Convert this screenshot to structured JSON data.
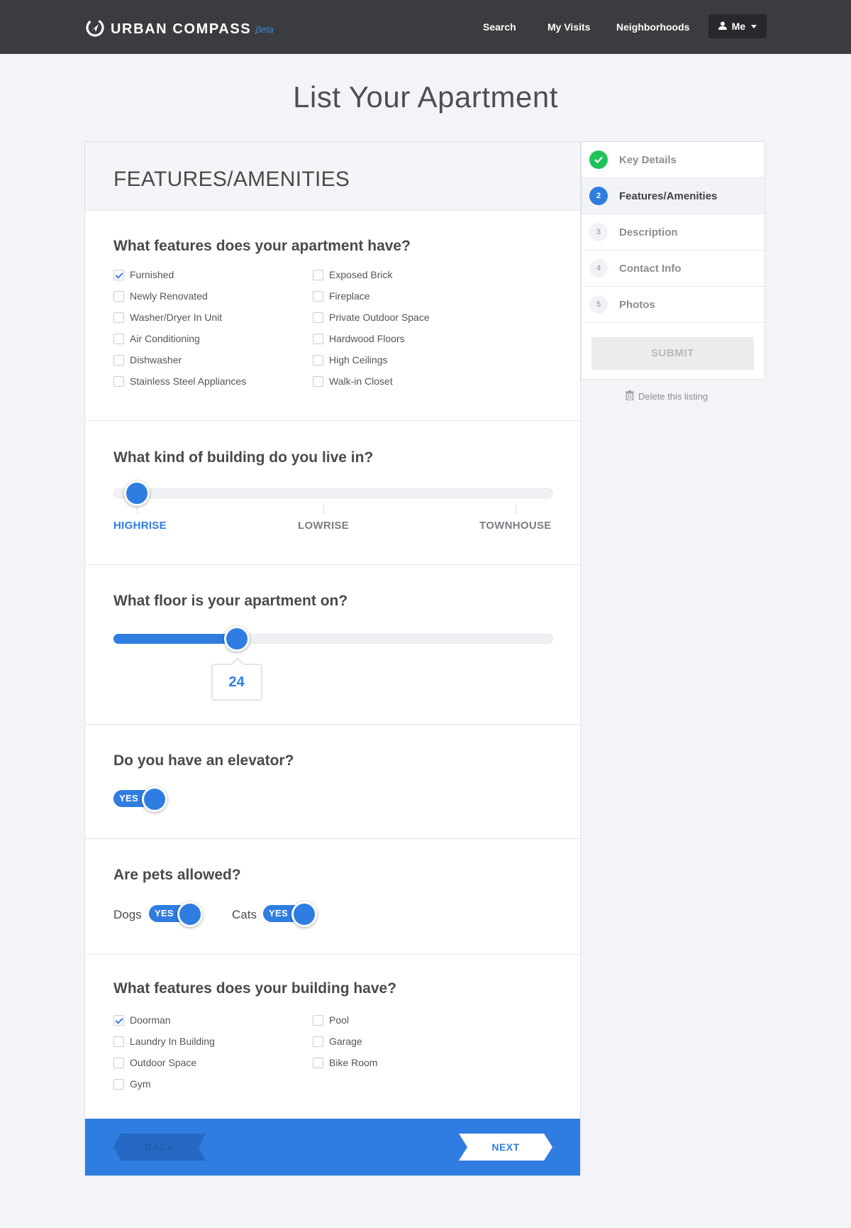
{
  "header": {
    "logo_text": "URBAN COMPASS",
    "logo_beta": "βeta",
    "nav": [
      "Search",
      "My Visits",
      "Neighborhoods"
    ],
    "user_menu_label": "Me",
    "icons": [
      "compass-logo-icon",
      "user-icon",
      "caret-down-icon"
    ]
  },
  "page": {
    "title": "List Your Apartment"
  },
  "card": {
    "heading": "FEATURES/AMENITIES",
    "apartment_features": {
      "question": "What features does your apartment have?",
      "options": [
        {
          "label": "Furnished",
          "checked": true
        },
        {
          "label": "Newly Renovated",
          "checked": false
        },
        {
          "label": "Washer/Dryer In Unit",
          "checked": false
        },
        {
          "label": "Air Conditioning",
          "checked": false
        },
        {
          "label": "Dishwasher",
          "checked": false
        },
        {
          "label": "Stainless Steel Appliances",
          "checked": false
        },
        {
          "label": "Exposed Brick",
          "checked": false
        },
        {
          "label": "Fireplace",
          "checked": false
        },
        {
          "label": "Private Outdoor Space",
          "checked": false
        },
        {
          "label": "Hardwood Floors",
          "checked": false
        },
        {
          "label": "High Ceilings",
          "checked": false
        },
        {
          "label": "Walk-in Closet",
          "checked": false
        }
      ]
    },
    "building_type": {
      "question": "What kind of building do you live in?",
      "options": [
        "HIGHRISE",
        "LOWRISE",
        "TOWNHOUSE"
      ],
      "selected": "HIGHRISE"
    },
    "floor": {
      "question": "What floor is your apartment on?",
      "value": "24",
      "level_fraction": 0.28
    },
    "elevator": {
      "question": "Do you have an elevator?",
      "toggle_label": "YES"
    },
    "pets": {
      "question": "Are pets allowed?",
      "dogs_label": "Dogs",
      "cats_label": "Cats",
      "dogs_toggle": "YES",
      "cats_toggle": "YES"
    },
    "building_features": {
      "question": "What features does your building have?",
      "options": [
        {
          "label": "Doorman",
          "checked": true
        },
        {
          "label": "Laundry In Building",
          "checked": false
        },
        {
          "label": "Outdoor Space",
          "checked": false
        },
        {
          "label": "Gym",
          "checked": false
        },
        {
          "label": "Pool",
          "checked": false
        },
        {
          "label": "Garage",
          "checked": false
        },
        {
          "label": "Bike Room",
          "checked": false
        }
      ]
    },
    "footer": {
      "back_label": "BACK",
      "next_label": "NEXT"
    }
  },
  "sidebar": {
    "steps": [
      {
        "num": "",
        "label": "Key Details",
        "state": "done"
      },
      {
        "num": "2",
        "label": "Features/Amenities",
        "state": "current"
      },
      {
        "num": "3",
        "label": "Description",
        "state": "todo"
      },
      {
        "num": "4",
        "label": "Contact Info",
        "state": "todo"
      },
      {
        "num": "5",
        "label": "Photos",
        "state": "todo"
      }
    ],
    "submit_label": "SUBMIT",
    "delete_label": "Delete this listing"
  },
  "colors": {
    "accent": "#2f7de1",
    "topbar": "#3a3c40",
    "success": "#1fc35a",
    "page_bg": "#f3f4f8"
  }
}
